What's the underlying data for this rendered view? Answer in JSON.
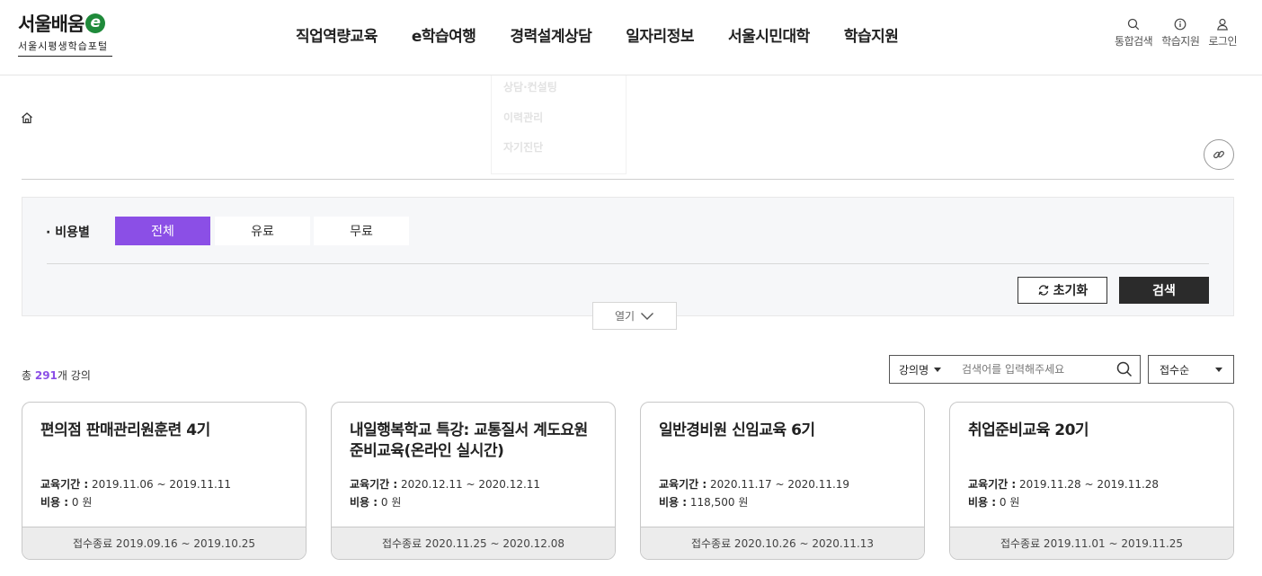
{
  "header": {
    "logo_text": "서울배움",
    "logo_mark": "e",
    "logo_sub": "서울시평생학습포털",
    "nav": [
      "직업역량교육",
      "e학습여행",
      "경력설계상담",
      "일자리정보",
      "서울시민대학",
      "학습지원"
    ],
    "utils": [
      {
        "label": "통합검색",
        "icon": "search-icon"
      },
      {
        "label": "학습지원",
        "icon": "info-icon"
      },
      {
        "label": "로그인",
        "icon": "user-icon"
      }
    ]
  },
  "dropdown_ghost": {
    "col3": [
      "상담·컨설팅",
      "이력관리",
      "자기진단"
    ]
  },
  "filter": {
    "label": "· 비용별",
    "options": [
      "전체",
      "유료",
      "무료"
    ],
    "selected": "전체",
    "reset_label": "초기화",
    "search_label": "검색",
    "toggle_label": "열기"
  },
  "results": {
    "total_prefix": "총 ",
    "total_count": "291",
    "total_suffix": "개 강의",
    "search_type": "강의명",
    "search_placeholder": "검색어를 입력해주세요",
    "sort": "접수순"
  },
  "courses": [
    {
      "title": "편의점 판매관리원훈련 4기",
      "period_label": "교육기간 :",
      "period": "2019.11.06 ~ 2019.11.11",
      "cost_label": "비용 :",
      "cost": "0 원",
      "status": "접수종료 2019.09.16 ~ 2019.10.25"
    },
    {
      "title": "내일행복학교 특강: 교통질서 계도요원 준비교육(온라인 실시간)",
      "period_label": "교육기간 :",
      "period": "2020.12.11 ~ 2020.12.11",
      "cost_label": "비용 :",
      "cost": "0 원",
      "status": "접수종료 2020.11.25 ~ 2020.12.08"
    },
    {
      "title": "일반경비원 신임교육 6기",
      "period_label": "교육기간 :",
      "period": "2020.11.17 ~ 2020.11.19",
      "cost_label": "비용 :",
      "cost": "118,500 원",
      "status": "접수종료 2020.10.26 ~ 2020.11.13"
    },
    {
      "title": "취업준비교육 20기",
      "period_label": "교육기간 :",
      "period": "2019.11.28 ~ 2019.11.28",
      "cost_label": "비용 :",
      "cost": "0 원",
      "status": "접수종료 2019.11.01 ~ 2019.11.25"
    }
  ],
  "colors": {
    "accent": "#8b4fe6",
    "logo_green": "#1f8a3a",
    "dark_button": "#2b2b2b"
  }
}
